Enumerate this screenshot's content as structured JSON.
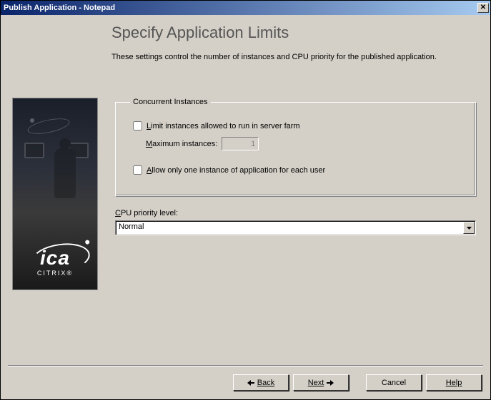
{
  "window": {
    "title": "Publish Application - Notepad",
    "close_glyph": "✕"
  },
  "header": {
    "title": "Specify Application Limits",
    "description": "These settings control the number of instances and CPU priority for the published application."
  },
  "sidebar": {
    "logo_text": "ica",
    "brand": "CITRIX",
    "reg": "®"
  },
  "group": {
    "legend": "Concurrent Instances",
    "limit_label": "Limit instances allowed to run in server farm",
    "max_label": "Maximum instances:",
    "max_value": "1",
    "one_per_user_label": "Allow only one instance of application for each user"
  },
  "cpu": {
    "label": "CPU priority level:",
    "value": "Normal"
  },
  "buttons": {
    "back": "Back",
    "next": "Next",
    "cancel": "Cancel",
    "help": "Help"
  }
}
